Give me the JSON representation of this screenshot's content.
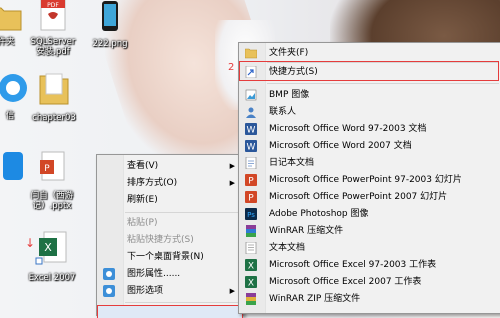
{
  "desktop": {
    "icons": [
      {
        "label": "件夹",
        "icon": "folder-icon"
      },
      {
        "label": "SQLServer\n安装.pdf",
        "icon": "pdf-icon",
        "badge": "PDF"
      },
      {
        "label": "222.png",
        "icon": "image-icon"
      },
      {
        "label": "信",
        "icon": "cloud-app-icon"
      },
      {
        "label": "chapter03",
        "icon": "folder-icon"
      },
      {
        "label": "闫自（西游\n记）.pptx",
        "icon": "pptx-icon"
      },
      {
        "label": "Excel 2007",
        "icon": "excel-icon"
      }
    ]
  },
  "context_menu": {
    "items": [
      {
        "label": "查看(V)",
        "submenu": true,
        "disabled": false
      },
      {
        "label": "排序方式(O)",
        "submenu": true,
        "disabled": false
      },
      {
        "label": "刷新(E)",
        "submenu": false,
        "disabled": false
      },
      {
        "label": "粘贴(P)",
        "submenu": false,
        "disabled": true
      },
      {
        "label": "粘贴快捷方式(S)",
        "submenu": false,
        "disabled": true
      },
      {
        "label": "下一个桌面背景(N)",
        "submenu": false,
        "disabled": false
      },
      {
        "label": "图形属性......",
        "submenu": false,
        "disabled": false,
        "icon": "graphics-icon"
      },
      {
        "label": "图形选项",
        "submenu": true,
        "disabled": false,
        "icon": "graphics-icon"
      }
    ]
  },
  "new_submenu": {
    "step_marker": "2",
    "items": [
      {
        "label": "文件夹(F)",
        "icon": "folder-icon"
      },
      {
        "label": "快捷方式(S)",
        "icon": "shortcut-icon"
      },
      {
        "label": "BMP 图像",
        "icon": "bmp-icon"
      },
      {
        "label": "联系人",
        "icon": "contact-icon"
      },
      {
        "label": "Microsoft Office Word 97-2003 文档",
        "icon": "word-icon"
      },
      {
        "label": "Microsoft Office Word 2007 文档",
        "icon": "word-icon"
      },
      {
        "label": "日记本文档",
        "icon": "journal-icon"
      },
      {
        "label": "Microsoft Office PowerPoint 97-2003 幻灯片",
        "icon": "powerpoint-icon"
      },
      {
        "label": "Microsoft Office PowerPoint 2007 幻灯片",
        "icon": "powerpoint-icon"
      },
      {
        "label": "Adobe Photoshop 图像",
        "icon": "photoshop-icon"
      },
      {
        "label": "WinRAR 压缩文件",
        "icon": "winrar-icon"
      },
      {
        "label": "文本文档",
        "icon": "text-icon"
      },
      {
        "label": "Microsoft Office Excel 97-2003 工作表",
        "icon": "excel-icon"
      },
      {
        "label": "Microsoft Office Excel 2007 工作表",
        "icon": "excel-icon"
      },
      {
        "label": "WinRAR ZIP 压缩文件",
        "icon": "winrar-zip-icon"
      }
    ]
  },
  "colors": {
    "highlight": "#e53c3c",
    "menu_bg": "#f1f1f1",
    "menu_border": "#979797"
  }
}
